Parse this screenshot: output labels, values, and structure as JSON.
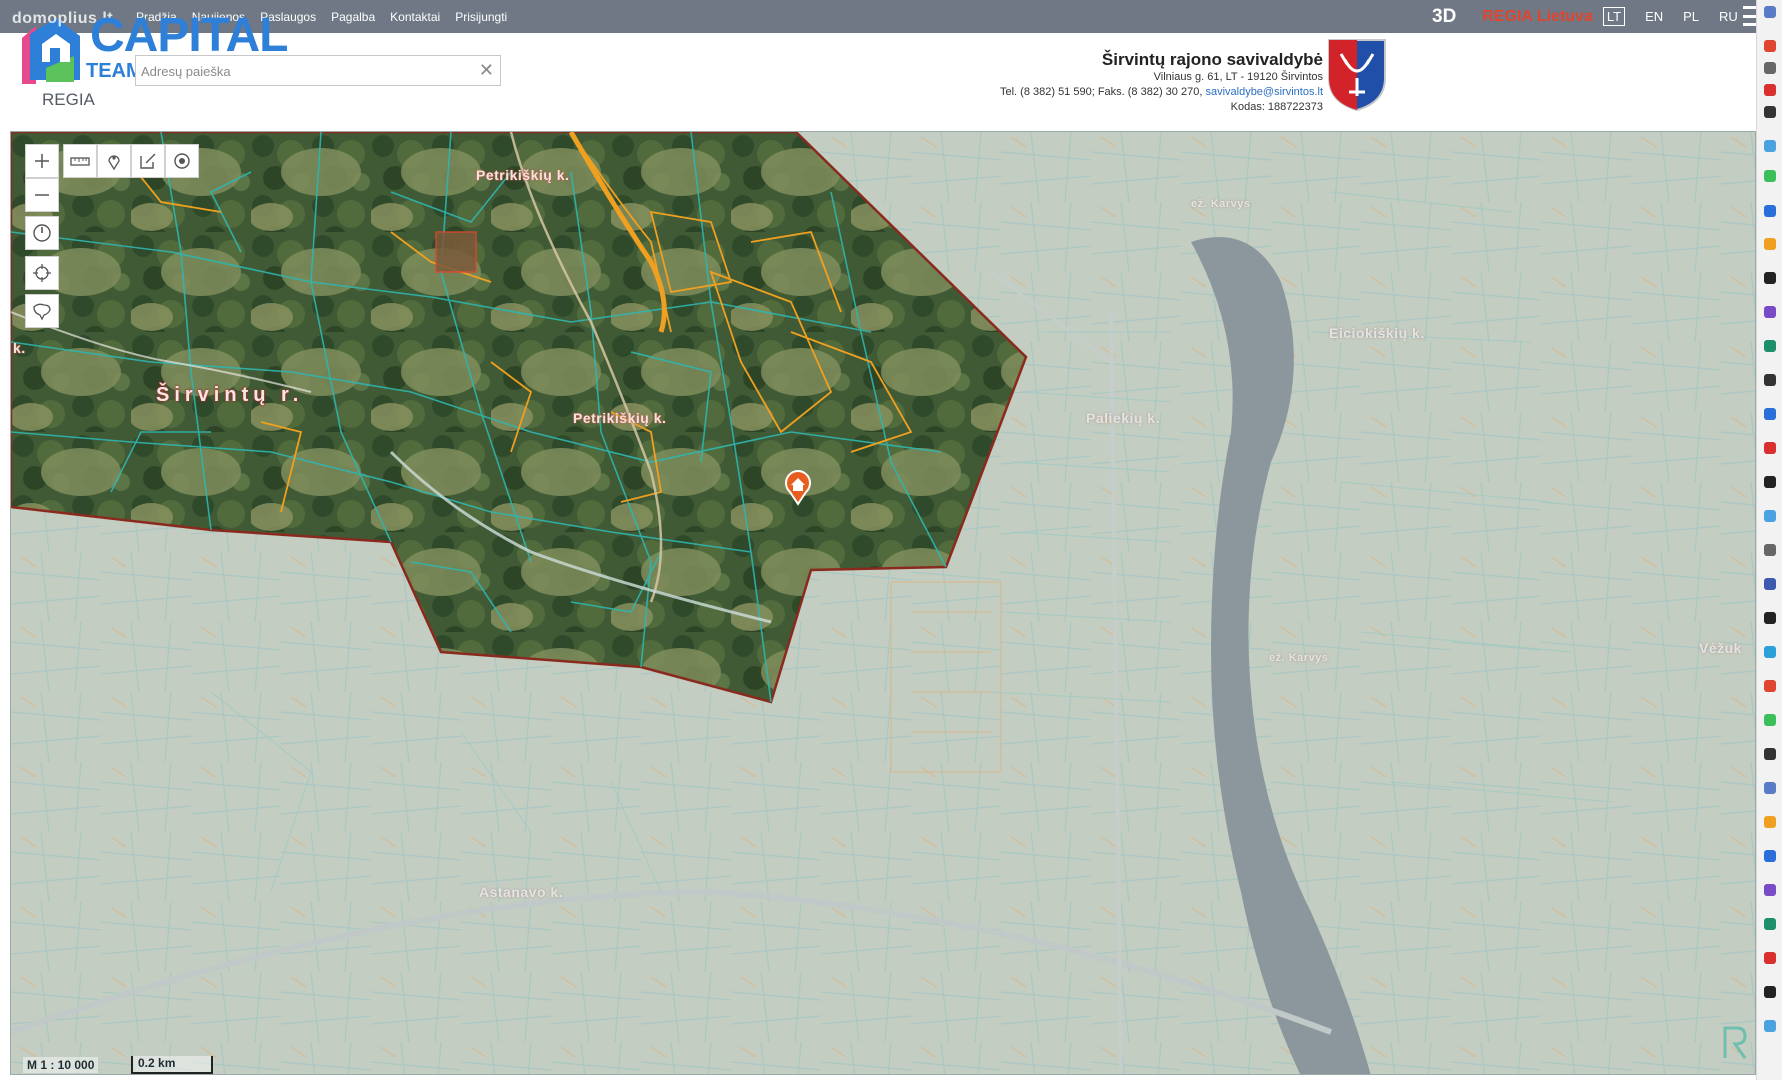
{
  "topbar": {
    "nav": [
      "Pradžia",
      "Naujienos",
      "Paslaugos",
      "Pagalba",
      "Kontaktai",
      "Prisijungti"
    ],
    "mode_3d": "3D",
    "brand": "REGIA Lietuva",
    "languages": [
      "LT",
      "EN",
      "PL",
      "RU"
    ],
    "active_language": "LT"
  },
  "logo": {
    "brand": "CAPITAL",
    "sub": "TEAM",
    "watermark": "domoplius.lt",
    "product": "REGIA"
  },
  "search": {
    "placeholder": "Adresų paieška"
  },
  "municipality": {
    "name": "Širvintų rajono savivaldybė",
    "address": "Vilniaus g. 61, LT - 19120 Širvintos",
    "phone": "Tel. (8 382) 51 590; Faks. (8 382) 30 270,",
    "email": "savivaldybe@sirvintos.lt",
    "code": "Kodas: 188722373"
  },
  "map": {
    "labels": {
      "village_top": "Petrikiškių k.",
      "village_center": "Petrikiškių k.",
      "region": "Širvintų r.",
      "left_edge": "k.",
      "village_right": "Paliekių k.",
      "village_east": "Eiciokiškių k.",
      "village_bottom": "Astanavo k.",
      "lake_top": "ež. Karvys",
      "lake_mid": "ež. Karvys",
      "right_edge": "Vėžuk"
    },
    "scale_ratio": "M 1 : 10 000",
    "scale_bar": "0.2 km",
    "colors": {
      "boundary": "#8a2a1e",
      "parcel_lines": "#2fb6b0",
      "highlight_parcels": "#f0a020",
      "lake": "#7e8f98"
    }
  },
  "tools": {
    "zoom_in": "zoom-in",
    "zoom_out": "zoom-out",
    "measure": "ruler-icon",
    "marker": "pin-icon",
    "edit": "edit-icon",
    "target": "target-icon",
    "history": "clock-icon",
    "locate": "crosshair-icon",
    "region": "region-icon"
  }
}
